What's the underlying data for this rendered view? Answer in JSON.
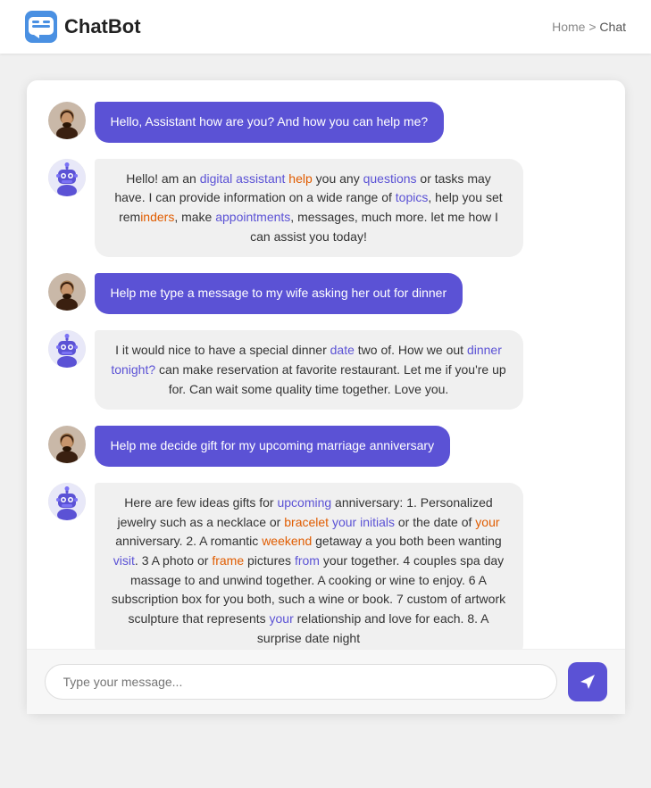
{
  "header": {
    "logo_text": "ChatBot",
    "breadcrumb_home": "Home",
    "breadcrumb_sep": ">",
    "breadcrumb_current": "Chat"
  },
  "messages": [
    {
      "id": 1,
      "type": "user",
      "text": "Hello, Assistant how are you? And how you can help me?"
    },
    {
      "id": 2,
      "type": "bot",
      "text": "Hello! am an digital assistant help you any questions or tasks may have. I can provide information on a wide range of topics, help you set reminders, make appointments, messages, much more. let me how I can assist you today!"
    },
    {
      "id": 3,
      "type": "user",
      "text": "Help me type a message to my wife asking her out for dinner"
    },
    {
      "id": 4,
      "type": "bot",
      "text": "I it would nice to have a special dinner date two of. How we out dinner tonight? can make reservation at favorite restaurant. Let me if you're up for. Can wait some quality time together. Love you."
    },
    {
      "id": 5,
      "type": "user",
      "text": "Help me decide gift for my upcoming marriage anniversary"
    },
    {
      "id": 6,
      "type": "bot",
      "text": "Here are few ideas gifts for upcoming anniversary: 1. Personalized jewelry such as a necklace or bracelet your initials or the date of your anniversary. 2. A romantic weekend getaway a you both been wanting visit. 3 A photo or frame pictures from your together. 4 couples spa day massage to and unwind together. A cooking or wine to enjoy. 6 A subscription box for you both, such a wine or book. 7 custom of artwork sculpture that represents your relationship and love for each. 8. A surprise date night"
    }
  ],
  "input": {
    "placeholder": "Type your message..."
  }
}
